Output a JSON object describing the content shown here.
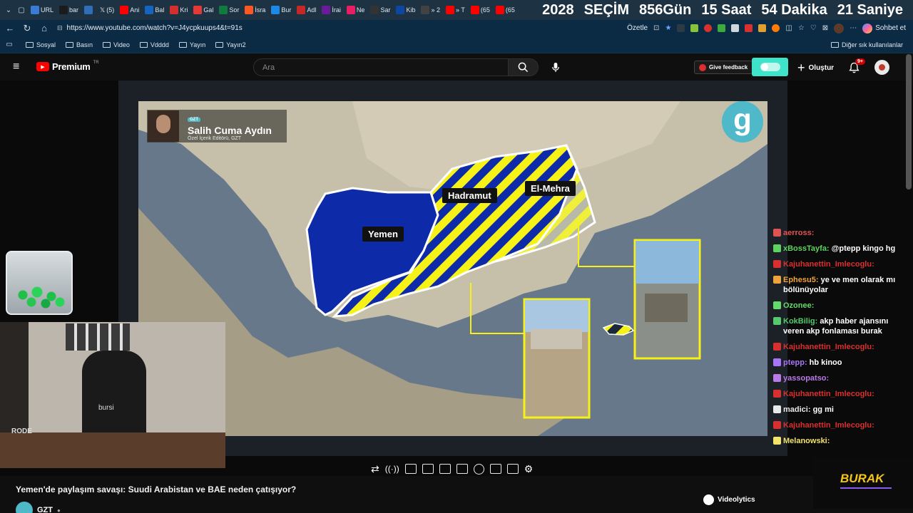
{
  "browser": {
    "tabs": [
      "URL",
      "bar",
      "",
      "Ani",
      "Bal",
      "Kri",
      "Gal",
      "Sor",
      "İsra",
      "Bur",
      "Adl",
      "İrai",
      "Ne",
      "Sar",
      "Kib",
      "» 2",
      "» T",
      "(65",
      "(65"
    ],
    "tab_x_label": "(5)",
    "countdown": {
      "year": "2028",
      "label": "SEÇİM",
      "days": "856Gün",
      "hours": "15 Saat",
      "minutes": "54 Dakika",
      "seconds": "21 Saniye"
    },
    "url": "https://www.youtube.com/watch?v=J4ycpkuups4&t=91s",
    "summarize": "Özetle",
    "chat_btn": "Sohbet et",
    "bookmarks": [
      "Sosyal",
      "Basın",
      "Video",
      "Vdddd",
      "Yayın",
      "Yayın2"
    ],
    "other_bookmarks": "Diğer sık kullanılanlar"
  },
  "youtube": {
    "logo": "Premium",
    "logo_sup": "TR",
    "search_placeholder": "Ara",
    "feedback": "Give feedback",
    "create": "Oluştur",
    "notif_count": "9+"
  },
  "video": {
    "presenter_tag": "GZT",
    "presenter_name": "Salih Cuma Aydın",
    "presenter_role": "Özel İçerik Editörü, GZT",
    "brand_letter": "g",
    "map_labels": {
      "yemen": "Yemen",
      "hadramut": "Hadramut",
      "mehra": "El-Mehra"
    },
    "title": "Yemen'de paylaşım savaşı: Suudi Arabistan ve BAE neden çatışıyor?",
    "channel": "GZT",
    "webcam_text": "bursi",
    "mic_text": "RODE",
    "streamer_badge": "BURAK",
    "videolytics": "Videolytics"
  },
  "chat": [
    {
      "user": "aerross:",
      "text": "",
      "color": "#e05353"
    },
    {
      "user": "xBossTayfa:",
      "text": "@ptepp kingo hg",
      "color": "#5fd35f"
    },
    {
      "user": "Kajuhanettin_Imlecoglu:",
      "text": "",
      "color": "#d9302f"
    },
    {
      "user": "Ephesu5:",
      "text": "ye ve men olarak mı bölünüyolar",
      "color": "#f0a33a"
    },
    {
      "user": "Ozonee:",
      "text": "",
      "color": "#65d96a"
    },
    {
      "user": "KokBilig:",
      "text": "akp haber ajansını veren akp fonlaması burak",
      "color": "#55c96c"
    },
    {
      "user": "Kajuhanettin_Imlecoglu:",
      "text": "",
      "color": "#d9302f"
    },
    {
      "user": "ptepp:",
      "text": "hb kinoo",
      "color": "#a875f5"
    },
    {
      "user": "yassopatso:",
      "text": "",
      "color": "#b979e6"
    },
    {
      "user": "Kajuhanettin_Imlecoglu:",
      "text": "",
      "color": "#d9302f"
    },
    {
      "user": "madici:",
      "text": "gg mi",
      "color": "#e8e8e8"
    },
    {
      "user": "Kajuhanettin_Imlecoglu:",
      "text": "",
      "color": "#d9302f"
    },
    {
      "user": "Melanowski:",
      "text": "",
      "color": "#f2e36b"
    }
  ],
  "colors": {
    "yt_red": "#ff0000",
    "map_yellow": "#f6f218",
    "yemen_blue": "#0d2aa8",
    "feedback_teal": "#3fe3c9"
  }
}
